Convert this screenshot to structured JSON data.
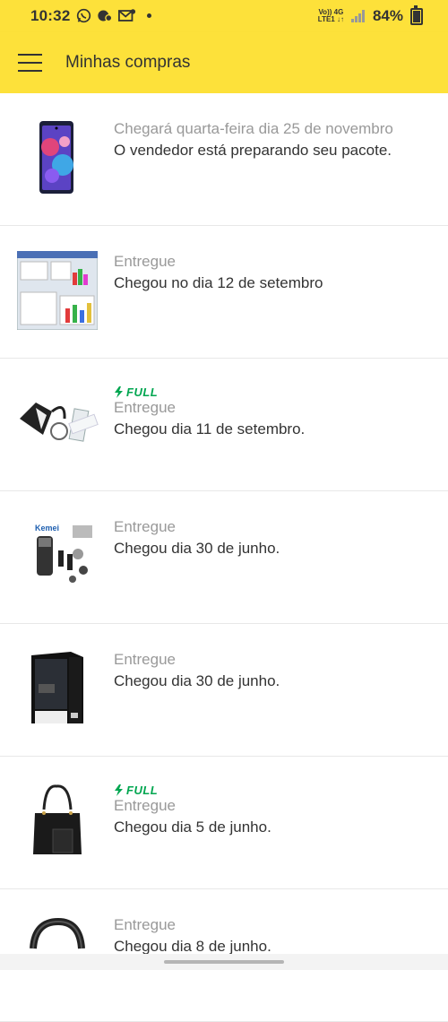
{
  "status_bar": {
    "time": "10:32",
    "network_top": "Vo)) 4G",
    "network_bottom": "LTE1 ↓↑",
    "battery": "84%",
    "battery_fraction": 0.84,
    "icons": [
      "whatsapp-icon",
      "dnd-icon",
      "email-icon"
    ]
  },
  "app_bar": {
    "title": "Minhas compras"
  },
  "colors": {
    "brand_yellow": "#fde13a",
    "full_green": "#00a650",
    "status_gray": "#999999",
    "text_dark": "#333333"
  },
  "orders": [
    {
      "full": "",
      "status": "Chegará quarta-feira dia 25 de novembro",
      "detail": "O vendedor está preparando seu pacote.",
      "product_icon": "smartphone-image"
    },
    {
      "full": "",
      "status": "Entregue",
      "detail": "Chegou no dia 12 de setembro",
      "product_icon": "software-screenshot-image"
    },
    {
      "full": "FULL",
      "status": "Entregue",
      "detail": "Chegou dia 11 de setembro.",
      "product_icon": "blood-pressure-monitor-image"
    },
    {
      "full": "",
      "status": "Entregue",
      "detail": "Chegou dia 30 de junho.",
      "product_icon": "shaver-kit-image",
      "brand_text": "Kemei"
    },
    {
      "full": "",
      "status": "Entregue",
      "detail": "Chegou dia 30 de junho.",
      "product_icon": "pc-case-image"
    },
    {
      "full": "FULL",
      "status": "Entregue",
      "detail": "Chegou dia 5 de junho.",
      "product_icon": "handbag-image"
    },
    {
      "full": "",
      "status": "Entregue",
      "detail": "Chegou dia 8 de junho.",
      "product_icon": "headband-image"
    }
  ]
}
